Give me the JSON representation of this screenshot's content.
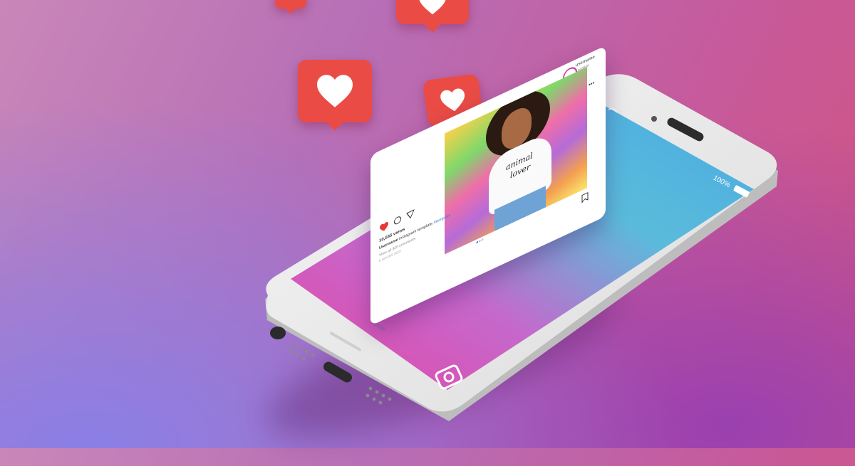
{
  "status_bar": {
    "battery": "100%"
  },
  "post": {
    "username": "username",
    "location": "Location",
    "views": "10,035 views",
    "caption_user": "Username",
    "caption_text": "instagram template",
    "hashtag": "#template",
    "comments_link": "View all 320 comments",
    "time_ago": "6 HOURS AGO",
    "shirt_text_line1": "animal",
    "shirt_text_line2": "lover"
  },
  "colors": {
    "heart_badge": "#ea4c45",
    "like_heart": "#e53935",
    "hashtag_link": "#3b7bd6"
  }
}
